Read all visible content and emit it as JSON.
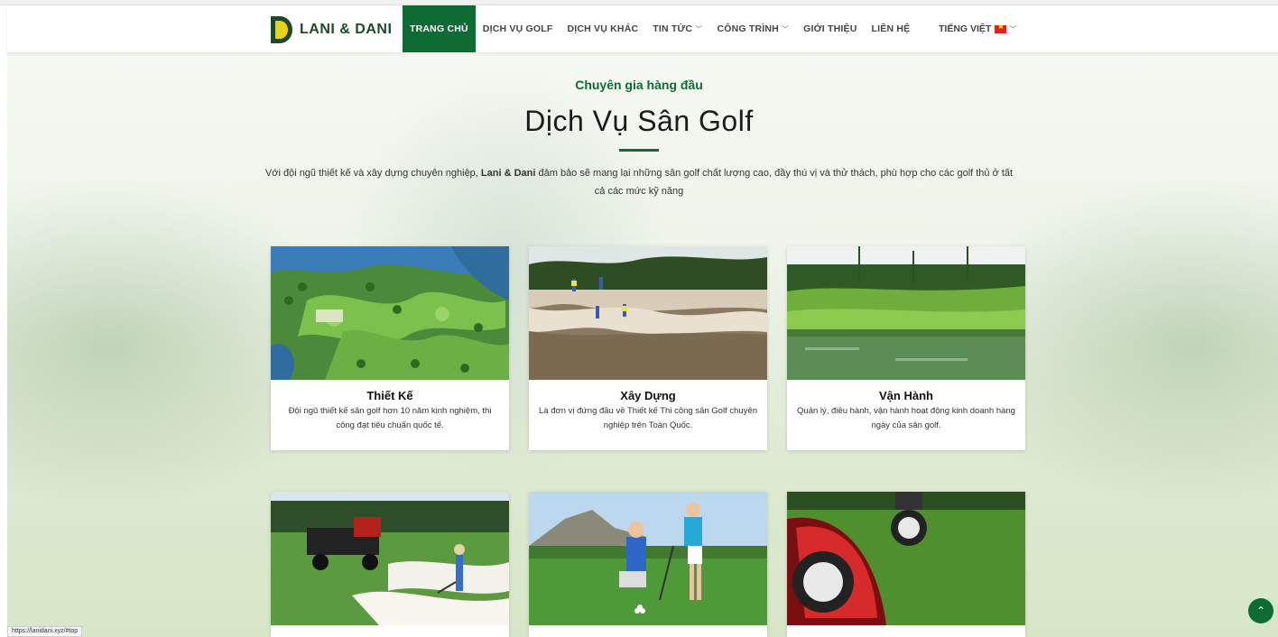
{
  "header": {
    "brand": "LANI & DANI",
    "nav": [
      {
        "label": "TRANG CHỦ",
        "active": true,
        "dropdown": false
      },
      {
        "label": "DỊCH VỤ GOLF",
        "active": false,
        "dropdown": false
      },
      {
        "label": "DỊCH VỤ KHÁC",
        "active": false,
        "dropdown": false
      },
      {
        "label": "TIN TỨC",
        "active": false,
        "dropdown": true
      },
      {
        "label": "CÔNG TRÌNH",
        "active": false,
        "dropdown": true
      },
      {
        "label": "GIỚI THIỆU",
        "active": false,
        "dropdown": false
      },
      {
        "label": "LIÊN HỆ",
        "active": false,
        "dropdown": false
      }
    ],
    "language": "TIẾNG VIỆT",
    "dropdown_glyph": "﹀"
  },
  "hero": {
    "kicker": "Chuyên gia hàng đầu",
    "title": "Dịch Vụ Sân Golf",
    "desc_pre": "Với đội ngũ thiết kế và xây dựng chuyên nghiệp, ",
    "desc_bold": "Lani & Dani",
    "desc_post": " đảm bảo sẽ mang lại những sân golf chất lượng cao, đầy thú vị và thử thách, phù hợp cho các golf thủ ở tất cả các mức kỹ năng"
  },
  "cards": [
    {
      "title": "Thiết Kế",
      "text": "Đội ngũ thiết kế sân golf hơn 10 năm kinh nghiệm, thi công đạt tiêu chuẩn quốc tế.",
      "image": "golf-course-plan-image"
    },
    {
      "title": "Xây Dựng",
      "text": "Là đơn vị đứng đầu về Thiết kế Thi công sân Golf chuyên nghiệp trên Toàn Quốc.",
      "image": "bunker-construction-image"
    },
    {
      "title": "Vận Hành",
      "text": "Quản lý, điều hành, vận hành hoạt động kinh doanh hàng ngày của sân golf.",
      "image": "golf-course-lake-image"
    },
    {
      "title": "",
      "text": "",
      "image": "maintenance-cart-image"
    },
    {
      "title": "",
      "text": "",
      "image": "golf-coaching-image"
    },
    {
      "title": "",
      "text": "",
      "image": "lawn-mower-image"
    }
  ],
  "status_url": "https://lanidani.xyz/#top",
  "scroll_top_glyph": "⌃",
  "colors": {
    "brand_green": "#0e6b33",
    "logo_yellow": "#e8d21a"
  }
}
